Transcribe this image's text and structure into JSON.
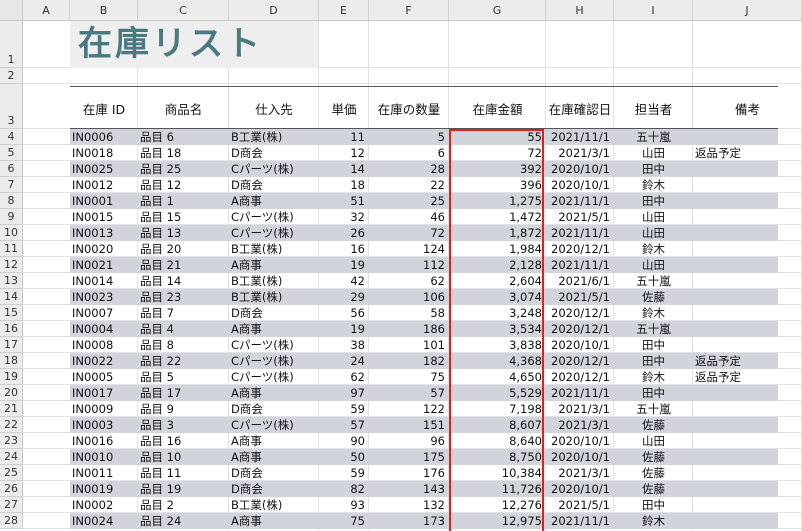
{
  "columns": [
    "A",
    "B",
    "C",
    "D",
    "E",
    "F",
    "G",
    "H",
    "I",
    "J"
  ],
  "title": "在庫リスト",
  "headers": [
    "在庫 ID",
    "商品名",
    "仕入先",
    "単価",
    "在庫の数量",
    "在庫金額",
    "在庫確認日",
    "担当者",
    "備考"
  ],
  "rows": [
    [
      "IN0006",
      "品目 6",
      "B工業(株)",
      "11",
      "5",
      "55",
      "2021/11/1",
      "五十嵐",
      ""
    ],
    [
      "IN0018",
      "品目 18",
      "D商会",
      "12",
      "6",
      "72",
      "2021/3/1",
      "山田",
      "返品予定"
    ],
    [
      "IN0025",
      "品目 25",
      "Cパーツ(株)",
      "14",
      "28",
      "392",
      "2020/10/1",
      "田中",
      ""
    ],
    [
      "IN0012",
      "品目 12",
      "D商会",
      "18",
      "22",
      "396",
      "2020/10/1",
      "鈴木",
      ""
    ],
    [
      "IN0001",
      "品目 1",
      "A商事",
      "51",
      "25",
      "1,275",
      "2021/11/1",
      "田中",
      ""
    ],
    [
      "IN0015",
      "品目 15",
      "Cパーツ(株)",
      "32",
      "46",
      "1,472",
      "2021/5/1",
      "山田",
      ""
    ],
    [
      "IN0013",
      "品目 13",
      "Cパーツ(株)",
      "26",
      "72",
      "1,872",
      "2021/11/1",
      "山田",
      ""
    ],
    [
      "IN0020",
      "品目 20",
      "B工業(株)",
      "16",
      "124",
      "1,984",
      "2020/12/1",
      "鈴木",
      ""
    ],
    [
      "IN0021",
      "品目 21",
      "A商事",
      "19",
      "112",
      "2,128",
      "2021/11/1",
      "山田",
      ""
    ],
    [
      "IN0014",
      "品目 14",
      "B工業(株)",
      "42",
      "62",
      "2,604",
      "2021/6/1",
      "五十嵐",
      ""
    ],
    [
      "IN0023",
      "品目 23",
      "B工業(株)",
      "29",
      "106",
      "3,074",
      "2021/5/1",
      "佐藤",
      ""
    ],
    [
      "IN0007",
      "品目 7",
      "D商会",
      "56",
      "58",
      "3,248",
      "2020/12/1",
      "鈴木",
      ""
    ],
    [
      "IN0004",
      "品目 4",
      "A商事",
      "19",
      "186",
      "3,534",
      "2020/12/1",
      "五十嵐",
      ""
    ],
    [
      "IN0008",
      "品目 8",
      "Cパーツ(株)",
      "38",
      "101",
      "3,838",
      "2020/10/1",
      "田中",
      ""
    ],
    [
      "IN0022",
      "品目 22",
      "Cパーツ(株)",
      "24",
      "182",
      "4,368",
      "2020/12/1",
      "田中",
      "返品予定"
    ],
    [
      "IN0005",
      "品目 5",
      "Cパーツ(株)",
      "62",
      "75",
      "4,650",
      "2020/12/1",
      "鈴木",
      "返品予定"
    ],
    [
      "IN0017",
      "品目 17",
      "A商事",
      "97",
      "57",
      "5,529",
      "2021/11/1",
      "田中",
      ""
    ],
    [
      "IN0009",
      "品目 9",
      "D商会",
      "59",
      "122",
      "7,198",
      "2021/3/1",
      "五十嵐",
      ""
    ],
    [
      "IN0003",
      "品目 3",
      "Cパーツ(株)",
      "57",
      "151",
      "8,607",
      "2021/3/1",
      "佐藤",
      ""
    ],
    [
      "IN0016",
      "品目 16",
      "A商事",
      "90",
      "96",
      "8,640",
      "2020/10/1",
      "山田",
      ""
    ],
    [
      "IN0010",
      "品目 10",
      "A商事",
      "50",
      "175",
      "8,750",
      "2020/10/1",
      "佐藤",
      ""
    ],
    [
      "IN0011",
      "品目 11",
      "D商会",
      "59",
      "176",
      "10,384",
      "2021/3/1",
      "佐藤",
      ""
    ],
    [
      "IN0019",
      "品目 19",
      "D商会",
      "82",
      "143",
      "11,726",
      "2020/10/1",
      "佐藤",
      ""
    ],
    [
      "IN0002",
      "品目 2",
      "B工業(株)",
      "93",
      "132",
      "12,276",
      "2021/5/1",
      "田中",
      ""
    ],
    [
      "IN0024",
      "品目 24",
      "A商事",
      "75",
      "173",
      "12,975",
      "2021/11/1",
      "鈴木",
      ""
    ]
  ],
  "row_numbers": [
    "1",
    "2",
    "3",
    "4",
    "5",
    "6",
    "7",
    "8",
    "9",
    "10",
    "11",
    "12",
    "13",
    "14",
    "15",
    "16",
    "17",
    "18",
    "19",
    "20",
    "21",
    "22",
    "23",
    "24",
    "25",
    "26",
    "27",
    "28"
  ],
  "colors": {
    "band": "#d1d5db",
    "title": "#4a7a80",
    "highlight_border": "#e02020"
  }
}
